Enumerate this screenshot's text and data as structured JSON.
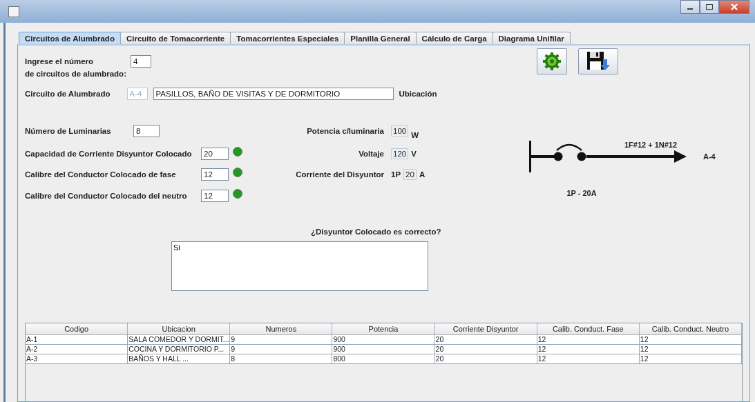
{
  "tabs": [
    {
      "label": "Circuitos de Alumbrado",
      "selected": true
    },
    {
      "label": "Circuito de Tomacorriente",
      "selected": false
    },
    {
      "label": "Tomacorrientes Especiales",
      "selected": false
    },
    {
      "label": "Planilla General",
      "selected": false
    },
    {
      "label": "Cálculo de Carga",
      "selected": false
    },
    {
      "label": "Diagrama Unifilar",
      "selected": false
    }
  ],
  "count": {
    "label_line1": "Ingrese el número",
    "label_line2": "de circuitos de alumbrado:",
    "value": "4"
  },
  "circuit": {
    "label": "Circuito de Alumbrado",
    "code": "A-4",
    "code_disabled": true,
    "location": "PASILLOS, BAÑO DE VISITAS Y DE DORMITORIO",
    "location_label": "Ubicación"
  },
  "left_fields": [
    {
      "label": "Número de Luminarias",
      "value": "8"
    },
    {
      "label": "Capacidad de Corriente Disyuntor Colocado",
      "value": "20",
      "led_on": true
    },
    {
      "label": "Calibre del Conductor Colocado de fase",
      "value": "12",
      "led_on": true
    },
    {
      "label": "Calibre del Conductor Colocado del neutro",
      "value": "12",
      "led_on": true
    }
  ],
  "right_fields": [
    {
      "label": "Potencia c/luminaria",
      "value": "100",
      "unit": "W"
    },
    {
      "label": "Voltaje",
      "value": "120",
      "unit": "V"
    },
    {
      "label": "Corriente del Disyuntor",
      "prefix": "1P",
      "value": "20",
      "unit": "A"
    }
  ],
  "diagram": {
    "conductors": "1F#12 + 1N#12",
    "circuit": "A-4",
    "breaker": "1P - 20A"
  },
  "question": {
    "label": "¿Disyuntor Colocado es correcto?",
    "answer": "Si"
  },
  "table": {
    "columns": [
      "Codigo",
      "Ubicacion",
      "Numeros",
      "Potencia",
      "Corriente Disyuntor",
      "Calib. Conduct. Fase",
      "Calib. Conduct. Neutro"
    ],
    "rows": [
      [
        "A-1",
        "SALA COMEDOR Y DORMIT...",
        "9",
        "900",
        "20",
        "12",
        "12"
      ],
      [
        "A-2",
        "COCINA Y DORMITORIO P...",
        "9",
        "900",
        "20",
        "12",
        "12"
      ],
      [
        "A-3",
        "BAÑOS Y HALL ...",
        "8",
        "800",
        "20",
        "12",
        "12"
      ]
    ]
  }
}
